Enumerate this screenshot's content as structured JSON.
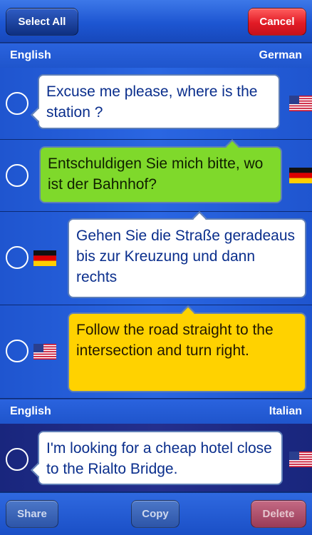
{
  "toolbar": {
    "select_all": "Select All",
    "cancel": "Cancel"
  },
  "sections": [
    {
      "left_language": "English",
      "right_language": "German",
      "rows": [
        {
          "text": "Excuse me please, where is the station ?",
          "bubble_color": "#ffffff",
          "flag": "us-flag-icon",
          "selected": false
        },
        {
          "text": "Entschuldigen Sie mich bitte, wo ist der Bahnhof?",
          "bubble_color": "#7fd92b",
          "flag": "german-flag-icon",
          "selected": false
        },
        {
          "text": "Gehen Sie die Straße geradeaus bis zur Kreuzung und dann rechts",
          "bubble_color": "#ffffff",
          "flag": "german-flag-icon",
          "selected": false
        },
        {
          "text": "Follow the road straight to the intersection and turn right.",
          "bubble_color": "#ffd200",
          "flag": "us-flag-icon",
          "selected": false
        }
      ]
    },
    {
      "left_language": "English",
      "right_language": "Italian",
      "rows": [
        {
          "text": "I'm looking for a cheap hotel close to the Rialto Bridge.",
          "bubble_color": "#ffffff",
          "flag": "us-flag-icon",
          "selected": false
        }
      ]
    }
  ],
  "bottom_toolbar": {
    "share": "Share",
    "copy": "Copy",
    "delete": "Delete"
  }
}
